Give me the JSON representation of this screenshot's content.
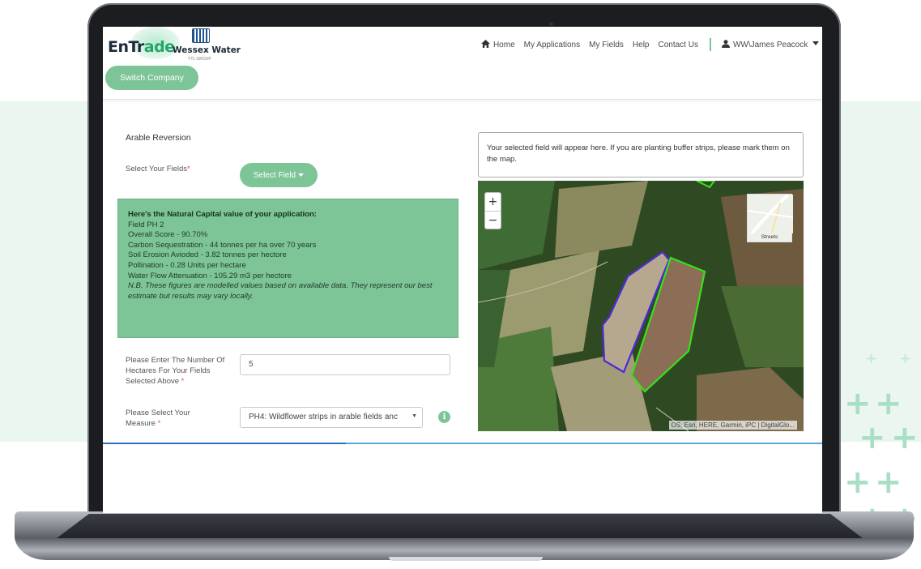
{
  "header": {
    "brand": {
      "entrade_main": "EnTr",
      "entrade_accent": "ade",
      "partner": "Wessex Water",
      "partner_sub": "YTL GROUP"
    },
    "switch_company_label": "Switch Company",
    "nav": {
      "home": "Home",
      "my_applications": "My Applications",
      "my_fields": "My Fields",
      "help": "Help",
      "contact_us": "Contact Us",
      "user": "WW\\James Peacock"
    }
  },
  "form": {
    "section_title": "Arable Reversion",
    "select_fields_label": "Select Your Fields",
    "required_marker": "*",
    "select_field_button": "Select Field",
    "hectares_label": "Please Enter The Number Of Hectares For Your Fields Selected Above",
    "hectares_value": "5",
    "measure_label": "Please Select Your Measure",
    "measure_value": "PH4: Wildflower strips in arable fields anc"
  },
  "natural_capital": {
    "title": "Here's the Natural Capital value of your application:",
    "lines": [
      "Field PH 2",
      "Overall Score - 90.70%",
      "Carbon Sequestration - 44 tonnes per ha over 70 years",
      "Soil Erosion Avioded - 3.82 tonnes per hectore",
      "Pollination - 0.28 Units per hectare",
      "Water Flow Attenuation - 105.29 m3 per hectore"
    ],
    "note": "N.B. These figures are modelled values based on available data. They represent our best estimate but results may vary locally."
  },
  "map": {
    "notice": "Your selected field will appear here. If you are planting buffer strips, please mark them on the map.",
    "zoom_in": "+",
    "zoom_out": "−",
    "basemap_label": "Streets",
    "attribution": "OS, Esri, HERE, Garmin, iPC | DigitalGlo..."
  },
  "colors": {
    "brand_green": "#7dc596",
    "field_outline_selected": "#4b2bd6",
    "field_outline_buffer": "#39e01c",
    "link_blue": "#2a72b5"
  },
  "icons": [
    "home-icon",
    "user-icon",
    "caret-down-icon",
    "info-icon",
    "zoom-in-icon",
    "zoom-out-icon"
  ]
}
